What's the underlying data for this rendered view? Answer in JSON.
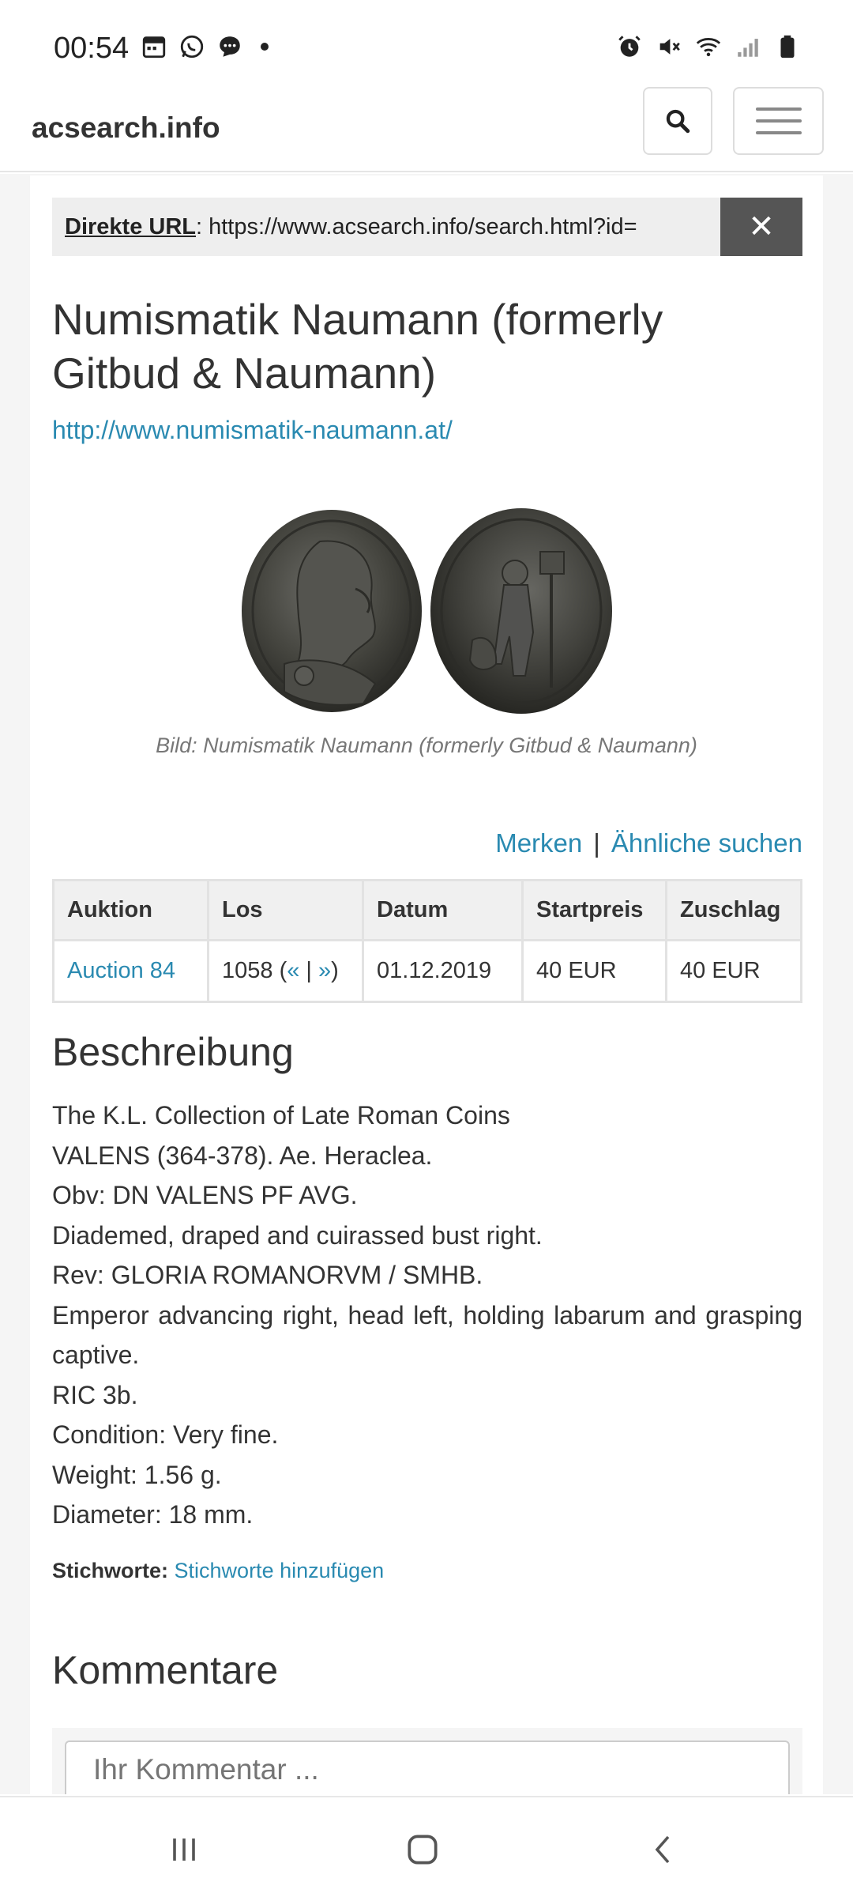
{
  "status_bar": {
    "time": "00:54",
    "left_icons": [
      "calendar-icon",
      "whatsapp-icon",
      "message-icon",
      "dot-icon"
    ],
    "right_icons": [
      "alarm-icon",
      "mute-icon",
      "wifi-icon",
      "signal-icon",
      "battery-icon"
    ]
  },
  "navbar": {
    "brand": "acsearch.info",
    "search_icon": "search-icon",
    "menu_icon": "hamburger-menu-icon"
  },
  "url_bar": {
    "label": "Direkte URL",
    "separator": ":",
    "value": " https://www.acsearch.info/search.html?id=",
    "close_glyph": "✕"
  },
  "lot": {
    "house_title": "Numismatik Naumann (formerly Gitbud & Naumann)",
    "house_url": "http://www.numismatik-naumann.at/",
    "image_caption": "Bild: Numismatik Naumann (formerly Gitbud & Naumann)"
  },
  "actions": {
    "bookmark": "Merken",
    "separator": "|",
    "similar": "Ähnliche suchen"
  },
  "table": {
    "headers": [
      "Auktion",
      "Los",
      "Datum",
      "Startpreis",
      "Zuschlag"
    ],
    "row": {
      "auction": "Auction 84",
      "lot_number": "1058 (",
      "prev": "«",
      "pipe": " | ",
      "next": "»",
      "lot_close": ")",
      "date": "01.12.2019",
      "start_price": "40 EUR",
      "hammer": "40 EUR"
    }
  },
  "description": {
    "heading": "Beschreibung",
    "lines": [
      "The K.L. Collection of Late Roman Coins",
      "VALENS (364-378). Ae. Heraclea.",
      "Obv: DN VALENS PF AVG.",
      "Diademed, draped and cuirassed bust right.",
      "Rev: GLORIA ROMANORVM / SMHB.",
      "Emperor advancing right, head left, holding labarum and grasping captive.",
      "RIC 3b.",
      "Condition: Very fine.",
      "Weight: 1.56 g.",
      "Diameter: 18 mm."
    ]
  },
  "tags": {
    "label": "Stichworte:",
    "add_link": "Stichworte hinzufügen"
  },
  "comments": {
    "heading": "Kommentare",
    "placeholder": "Ihr Kommentar ..."
  },
  "colors": {
    "link": "#2a8ab1",
    "text": "#333333",
    "close_bg": "#555555"
  }
}
